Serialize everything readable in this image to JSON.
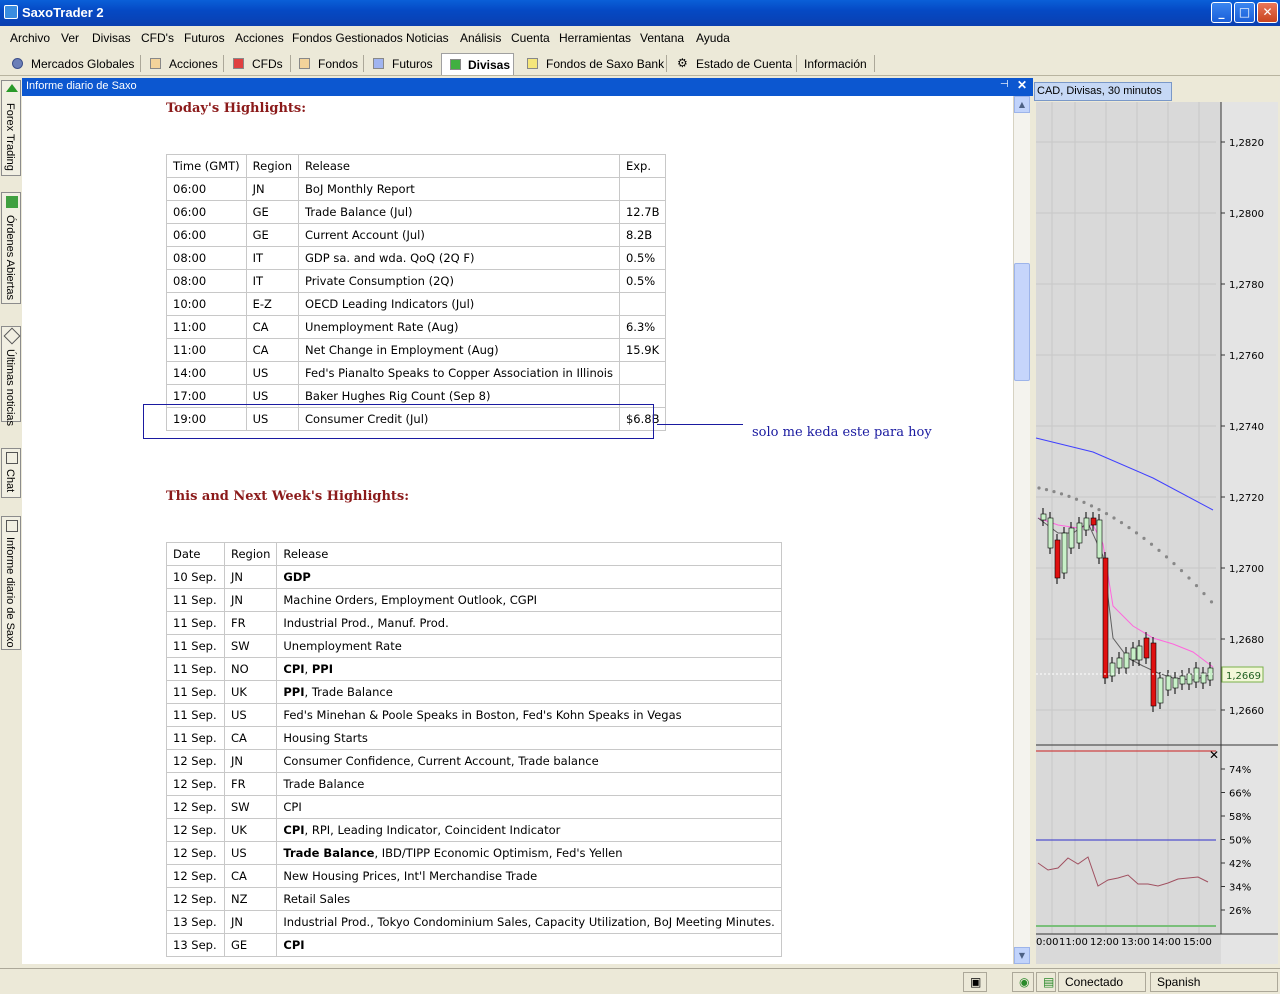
{
  "window": {
    "title": "SaxoTrader 2",
    "minimize": "_",
    "maximize": "□",
    "close": "✕"
  },
  "menu": [
    "Archivo",
    "Ver",
    "Divisas",
    "CFD's",
    "Futuros",
    "Acciones",
    "Fondos Gestionados",
    "Noticias",
    "Análisis",
    "Cuenta",
    "Herramientas",
    "Ventana",
    "Ayuda"
  ],
  "tabs": [
    {
      "label": "Mercados Globales",
      "icon": "gear-icon"
    },
    {
      "label": "Acciones",
      "icon": "stocks-icon"
    },
    {
      "label": "CFDs",
      "icon": "cfd-icon"
    },
    {
      "label": "Fondos",
      "icon": "funds-icon"
    },
    {
      "label": "Futuros",
      "icon": "futures-icon"
    },
    {
      "label": "Divisas",
      "icon": "fx-icon",
      "active": true
    },
    {
      "label": "Fondos de Saxo Bank",
      "icon": "saxo-funds-icon"
    },
    {
      "label": "Estado de Cuenta",
      "icon": "account-icon"
    },
    {
      "label": "Información"
    }
  ],
  "side_tabs": [
    "Forex Trading",
    "Órdenes Abiertas",
    "Últimas noticias",
    "Chat",
    "Informe diario de Saxo"
  ],
  "report": {
    "title": "Informe diario de Saxo",
    "today_heading": "Today's Highlights:",
    "today_columns": [
      "Time (GMT)",
      "Region",
      "Release",
      "Exp."
    ],
    "today_rows": [
      [
        "06:00",
        "JN",
        "BoJ Monthly Report",
        ""
      ],
      [
        "06:00",
        "GE",
        "Trade Balance (Jul)",
        "12.7B"
      ],
      [
        "06:00",
        "GE",
        "Current Account (Jul)",
        "8.2B"
      ],
      [
        "08:00",
        "IT",
        "GDP sa. and wda. QoQ (2Q F)",
        "0.5%"
      ],
      [
        "08:00",
        "IT",
        "Private Consumption (2Q)",
        "0.5%"
      ],
      [
        "10:00",
        "E-Z",
        "OECD Leading Indicators (Jul)",
        ""
      ],
      [
        "11:00",
        "CA",
        "Unemployment Rate (Aug)",
        "6.3%"
      ],
      [
        "11:00",
        "CA",
        "Net Change in Employment (Aug)",
        "15.9K"
      ],
      [
        "14:00",
        "US",
        "Fed's Pianalto Speaks to Copper Association in Illinois",
        ""
      ],
      [
        "17:00",
        "US",
        "Baker Hughes Rig Count (Sep 8)",
        ""
      ],
      [
        "19:00",
        "US",
        "Consumer Credit (Jul)",
        "$6.8B"
      ]
    ],
    "annotation": "solo me keda este para hoy",
    "week_heading": "This and Next Week's Highlights:",
    "week_columns": [
      "Date",
      "Region",
      "Release"
    ],
    "week_rows": [
      [
        "10 Sep.",
        "JN",
        "**GDP**"
      ],
      [
        "11 Sep.",
        "JN",
        "Machine Orders, Employment Outlook, CGPI"
      ],
      [
        "11 Sep.",
        "FR",
        "Industrial Prod., Manuf. Prod."
      ],
      [
        "11 Sep.",
        "SW",
        "Unemployment Rate"
      ],
      [
        "11 Sep.",
        "NO",
        "**CPI**, **PPI**"
      ],
      [
        "11 Sep.",
        "UK",
        "**PPI**, Trade Balance"
      ],
      [
        "11 Sep.",
        "US",
        "Fed's Minehan & Poole Speaks in Boston, Fed's Kohn Speaks in Vegas"
      ],
      [
        "11 Sep.",
        "CA",
        "Housing Starts"
      ],
      [
        "12 Sep.",
        "JN",
        "Consumer Confidence, Current Account, Trade balance"
      ],
      [
        "12 Sep.",
        "FR",
        "Trade Balance"
      ],
      [
        "12 Sep.",
        "SW",
        "CPI"
      ],
      [
        "12 Sep.",
        "UK",
        "**CPI**, RPI, Leading Indicator, Coincident Indicator"
      ],
      [
        "12 Sep.",
        "US",
        "**Trade Balance**, IBD/TIPP Economic Optimism, Fed's Yellen"
      ],
      [
        "12 Sep.",
        "CA",
        "New Housing Prices, Int'l Merchandise Trade"
      ],
      [
        "12 Sep.",
        "NZ",
        "Retail Sales"
      ],
      [
        "13 Sep.",
        "JN",
        "Industrial Prod., Tokyo Condominium Sales, Capacity Utilization, BoJ Meeting Minutes."
      ],
      [
        "13 Sep.",
        "GE",
        "**CPI**"
      ]
    ]
  },
  "chart": {
    "tab_label": "CAD, Divisas, 30 minutos",
    "price_axis": [
      "1,2820",
      "1,2800",
      "1,2780",
      "1,2760",
      "1,2740",
      "1,2720",
      "1,2700",
      "1,2680",
      "1,2660"
    ],
    "current_price": "1,2669",
    "indicator_axis": [
      "74%",
      "66%",
      "58%",
      "50%",
      "42%",
      "34%",
      "26%"
    ],
    "time_axis": [
      "0:00",
      "11:00",
      "12:00",
      "13:00",
      "14:00",
      "15:00"
    ],
    "indicator_close": "✕",
    "colors": {
      "up": "#ffffff",
      "down": "#e01010",
      "ma_fast": "#ff66dd",
      "ma_slow": "#4040ff",
      "ma_mid": "#606060",
      "dots": "#888888"
    }
  },
  "status": {
    "connection": "Conectado",
    "language": "Spanish"
  }
}
